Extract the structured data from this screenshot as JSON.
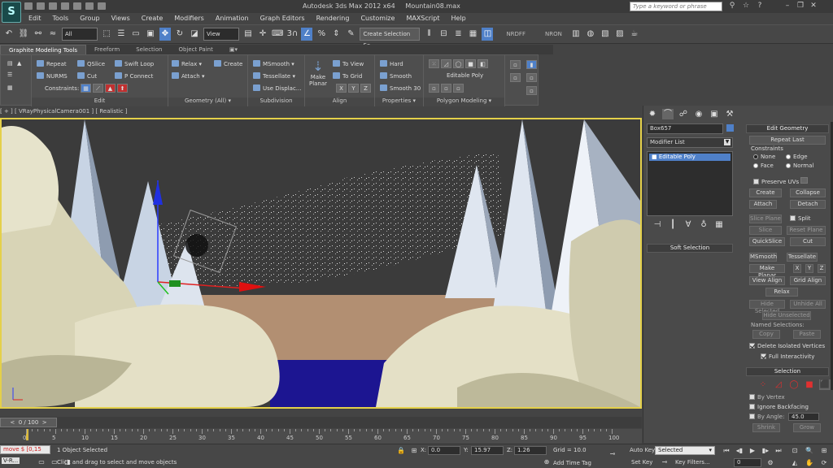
{
  "app": {
    "title": "Autodesk 3ds Max  2012 x64",
    "file": "Mountain08.max",
    "logo": "S"
  },
  "search_placeholder": "Type a keyword or phrase",
  "menus": [
    "Edit",
    "Tools",
    "Group",
    "Views",
    "Create",
    "Modifiers",
    "Animation",
    "Graph Editors",
    "Rendering",
    "Customize",
    "MAXScript",
    "Help"
  ],
  "toolbar": {
    "filter": "All",
    "ref_coord": "View",
    "snap_label": "3",
    "named_selection": "Create Selection Se",
    "nrdf": "NRDFF",
    "nron": "NRON"
  },
  "ribbon": {
    "tabs": [
      "Graphite Modeling Tools",
      "Freeform",
      "Selection",
      "Object Paint"
    ],
    "groups": {
      "edit": {
        "title": "Edit",
        "repeat": "Repeat",
        "qslice": "QSlice",
        "swift_loop": "Swift Loop",
        "nurms": "NURMS",
        "cut": "Cut",
        "p_connect": "P Connect",
        "constraints": "Constraints:"
      },
      "geometry": {
        "title": "Geometry (All)",
        "relax": "Relax",
        "create": "Create",
        "attach": "Attach"
      },
      "subdivision": {
        "title": "Subdivision",
        "msmooth": "MSmooth",
        "tessellate": "Tessellate",
        "use_displace": "Use Displac..."
      },
      "align": {
        "title": "Align",
        "make_planar": "Make Planar",
        "to_view": "To View",
        "to_grid": "To Grid",
        "x": "X",
        "y": "Y",
        "z": "Z"
      },
      "properties": {
        "title": "Properties",
        "hard": "Hard",
        "smooth": "Smooth",
        "smooth30": "Smooth 30"
      },
      "polygon": {
        "title": "Polygon Modeling",
        "editable_poly": "Editable Poly"
      }
    }
  },
  "viewport_label": "[ + ] [ VRayPhysicalCamera001 ] [ Realistic ]",
  "command_panel": {
    "object_name": "Box657",
    "modifier_list": "Modifier List",
    "stack": [
      "Editable Poly"
    ],
    "soft_selection": "Soft Selection",
    "edit_geometry": {
      "title": "Edit Geometry",
      "repeat_last": "Repeat Last",
      "constraints": "Constraints",
      "none": "None",
      "edge": "Edge",
      "face": "Face",
      "normal": "Normal",
      "preserve_uvs": "Preserve UVs",
      "create": "Create",
      "collapse": "Collapse",
      "attach": "Attach",
      "detach": "Detach",
      "slice_plane": "Slice Plane",
      "split": "Split",
      "slice": "Slice",
      "reset_plane": "Reset Plane",
      "quickslice": "QuickSlice",
      "cut": "Cut",
      "msmooth": "MSmooth",
      "tessellate": "Tessellate",
      "make_planar": "Make Planar",
      "x": "X",
      "y": "Y",
      "z": "Z",
      "view_align": "View Align",
      "grid_align": "Grid Align",
      "relax": "Relax",
      "hide_selected": "Hide Selected",
      "unhide_all": "Unhide All",
      "hide_unselected": "Hide Unselected",
      "named_selections": "Named Selections:",
      "copy": "Copy",
      "paste": "Paste",
      "delete_isolated": "Delete Isolated Vertices",
      "full_interactivity": "Full Interactivity"
    },
    "selection": {
      "title": "Selection",
      "by_vertex": "By Vertex",
      "ignore_backfacing": "Ignore Backfacing",
      "by_angle": "By Angle:",
      "angle_value": "45.0",
      "shrink": "Shrink",
      "grow": "Grow"
    }
  },
  "timeline": {
    "frame_display": "0 / 100",
    "ticks": [
      "0",
      "5",
      "10",
      "15",
      "20",
      "25",
      "30",
      "35",
      "40",
      "45",
      "50",
      "55",
      "60",
      "65",
      "70",
      "75",
      "80",
      "85",
      "90",
      "95",
      "100"
    ]
  },
  "status": {
    "maxscript": "move $ [0,15",
    "vray_tab": "V-R...",
    "selected_count": "1 Object Selected",
    "prompt": "Click and drag to select and move objects",
    "x_label": "X:",
    "x_val": "0.0",
    "y_label": "Y:",
    "y_val": "15.97",
    "z_label": "Z:",
    "z_val": "1.26",
    "grid": "Grid = 10.0",
    "add_time_tag": "Add Time Tag",
    "auto_key": "Auto Key",
    "set_key": "Set Key",
    "selected": "Selected",
    "key_filters": "Key Filters...",
    "frame": "0"
  }
}
